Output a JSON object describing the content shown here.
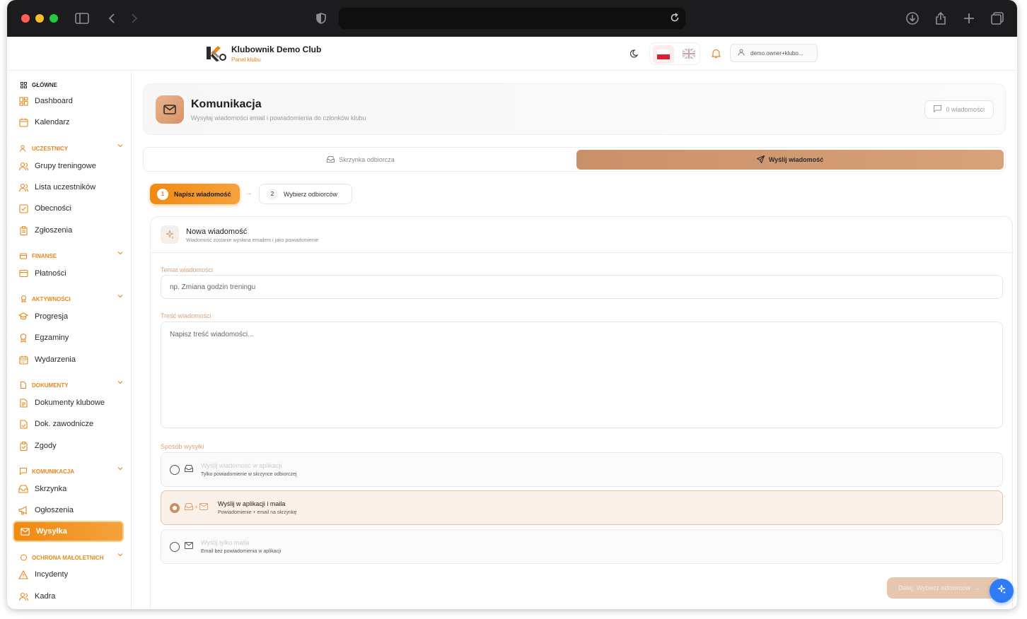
{
  "header": {
    "club_name": "Klubownik Demo Club",
    "club_sub": "Panel klubu",
    "user": "demo.owner+klubo..."
  },
  "sidebar": {
    "sections": {
      "main": "GŁÓWNE",
      "participants": "UCZESTNICY",
      "finance": "FINANSE",
      "activities": "AKTYWNOŚCI",
      "documents": "DOKUMENTY",
      "communication": "KOMUNIKACJA",
      "protection": "OCHRONA MAŁOLETNICH"
    },
    "items": {
      "dashboard": "Dashboard",
      "calendar": "Kalendarz",
      "groups": "Grupy treningowe",
      "participants_list": "Lista uczestników",
      "attendance": "Obecności",
      "applications": "Zgłoszenia",
      "payments": "Płatności",
      "progress": "Progresja",
      "exams": "Egzaminy",
      "events": "Wydarzenia",
      "club_docs": "Dokumenty klubowe",
      "player_docs": "Dok. zawodnicze",
      "consents": "Zgody",
      "inbox": "Skrzynka",
      "announcements": "Ogłoszenia",
      "dispatch": "Wysyłka",
      "incidents": "Incydenty",
      "staff": "Kadra"
    }
  },
  "page": {
    "title": "Komunikacja",
    "subtitle": "Wysyłaj wiadomości email i powiadomienia do członków klubu",
    "message_count": "0 wiadomości"
  },
  "tabs": {
    "inbox": "Skrzynka odbiorcza",
    "send": "Wyślij wiadomość"
  },
  "steps": {
    "step1_num": "1",
    "step1_label": "Napisz wiadomość",
    "step2_num": "2",
    "step2_label": "Wybierz odbiorców"
  },
  "form": {
    "title": "Nowa wiadomość",
    "subtitle": "Wiadomość zostanie wysłana emailem i jako powiadomienie",
    "subject_label": "Temat wiadomości",
    "subject_placeholder": "np. Zmiana godzin treningu",
    "body_label": "Treść wiadomości",
    "body_placeholder": "Napisz treść wiadomości...",
    "delivery_label": "Sposób wysyłki",
    "options": [
      {
        "title": "Wyślij wiadomość w aplikacji",
        "sub": "Tylko powiadomienie w skrzynce odbiorczej"
      },
      {
        "title": "Wyślij w aplikacji i maila",
        "sub": "Powiadomienie + email na skrzynkę"
      },
      {
        "title": "Wyślij tylko maila",
        "sub": "Email bez powiadomienia w aplikacji"
      }
    ],
    "selected_option": 1,
    "next_button": "Dalej: Wybierz odbiorców"
  },
  "colors": {
    "accent": "#f08a12",
    "accent_soft": "#c9916a",
    "fab": "#2f7bf5"
  }
}
